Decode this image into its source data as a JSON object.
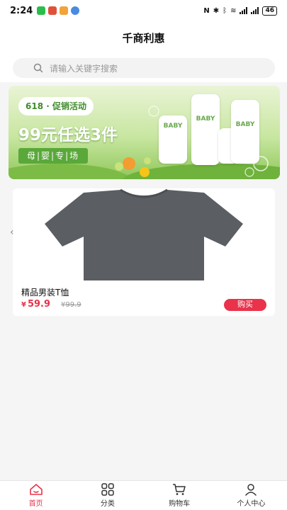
{
  "status_bar": {
    "time": "2:24",
    "battery": "46"
  },
  "header": {
    "title": "千商利惠"
  },
  "search": {
    "placeholder": "请输入关键字搜索",
    "icon": "search-icon"
  },
  "banner": {
    "pill": "618 · 促销活动",
    "headline": "99元任选3件",
    "subtitle": "母|婴|专|场",
    "bottle_label": "BABY",
    "colors": {
      "green_dark": "#3e8c2a",
      "green_mid": "#5aa83a",
      "green_light": "#e9f4d6"
    }
  },
  "product": {
    "name": "精品男装T恤",
    "price_symbol": "¥",
    "price": "59.9",
    "original_price": "¥99.9",
    "buy_label": "购买",
    "accent_color": "#e8334a"
  },
  "tabs": [
    {
      "label": "首页",
      "icon": "home-icon",
      "active": true
    },
    {
      "label": "分类",
      "icon": "grid-icon",
      "active": false
    },
    {
      "label": "购物车",
      "icon": "cart-icon",
      "active": false
    },
    {
      "label": "个人中心",
      "icon": "user-icon",
      "active": false
    }
  ]
}
